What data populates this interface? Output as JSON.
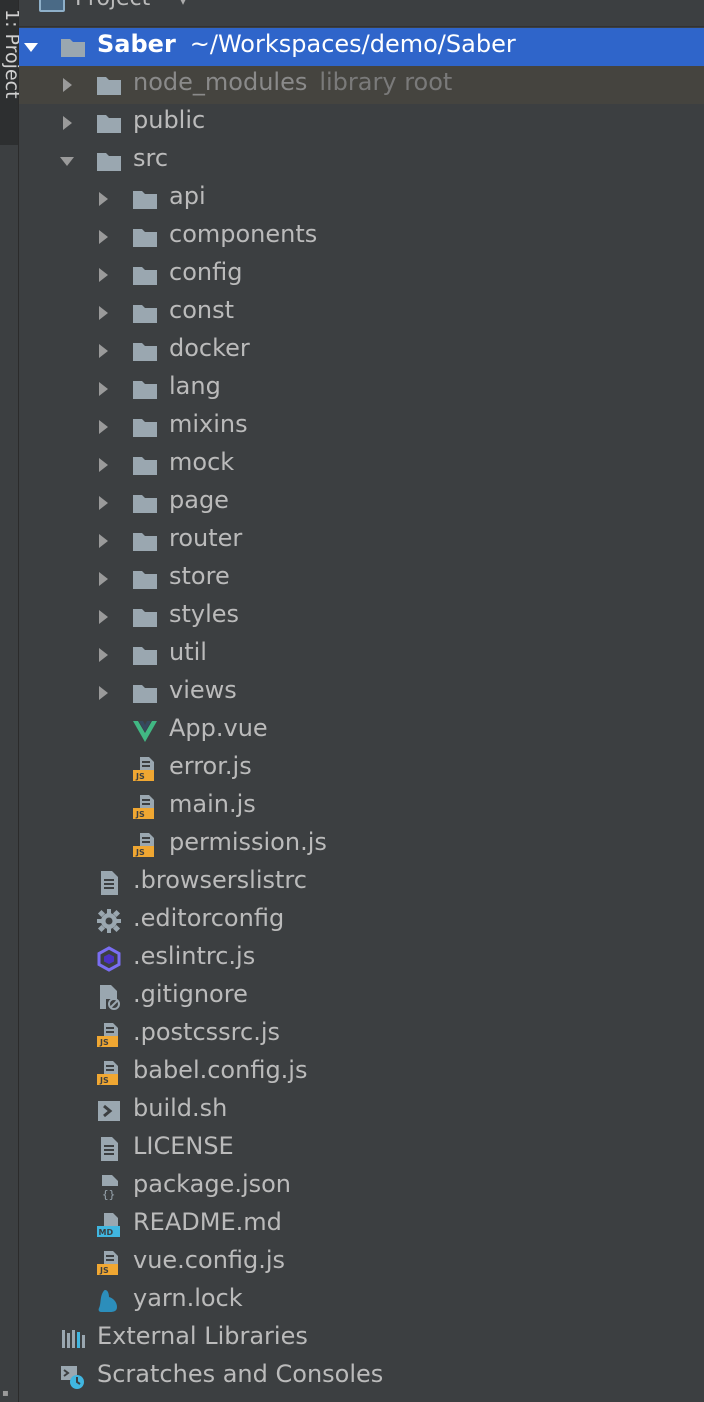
{
  "panel": {
    "title": "Project",
    "side_tab": "1: Project"
  },
  "tree": {
    "root": {
      "name": "Saber",
      "path": "~/Workspaces/demo/Saber"
    },
    "node_modules": {
      "name": "node_modules",
      "hint": "library root"
    },
    "public": {
      "name": "public"
    },
    "src": {
      "name": "src",
      "folders": [
        "api",
        "components",
        "config",
        "const",
        "docker",
        "lang",
        "mixins",
        "mock",
        "page",
        "router",
        "store",
        "styles",
        "util",
        "views"
      ],
      "files": [
        "App.vue",
        "error.js",
        "main.js",
        "permission.js"
      ]
    },
    "root_files": [
      {
        "name": ".browserslistrc",
        "icon": "text-file-icon"
      },
      {
        "name": ".editorconfig",
        "icon": "gear-icon"
      },
      {
        "name": ".eslintrc.js",
        "icon": "eslint-icon"
      },
      {
        "name": ".gitignore",
        "icon": "ignore-file-icon"
      },
      {
        "name": ".postcssrc.js",
        "icon": "js-file-icon"
      },
      {
        "name": "babel.config.js",
        "icon": "js-file-icon"
      },
      {
        "name": "build.sh",
        "icon": "shell-script-icon"
      },
      {
        "name": "LICENSE",
        "icon": "text-file-icon"
      },
      {
        "name": "package.json",
        "icon": "json-file-icon"
      },
      {
        "name": "README.md",
        "icon": "markdown-file-icon"
      },
      {
        "name": "vue.config.js",
        "icon": "js-file-icon"
      },
      {
        "name": "yarn.lock",
        "icon": "yarn-icon"
      }
    ],
    "external_libraries": "External Libraries",
    "scratches": "Scratches and Consoles"
  },
  "colors": {
    "background": "#3c3f41",
    "selection": "#2f65ca",
    "excluded": "#45443f",
    "folder": "#9aa7b0"
  }
}
